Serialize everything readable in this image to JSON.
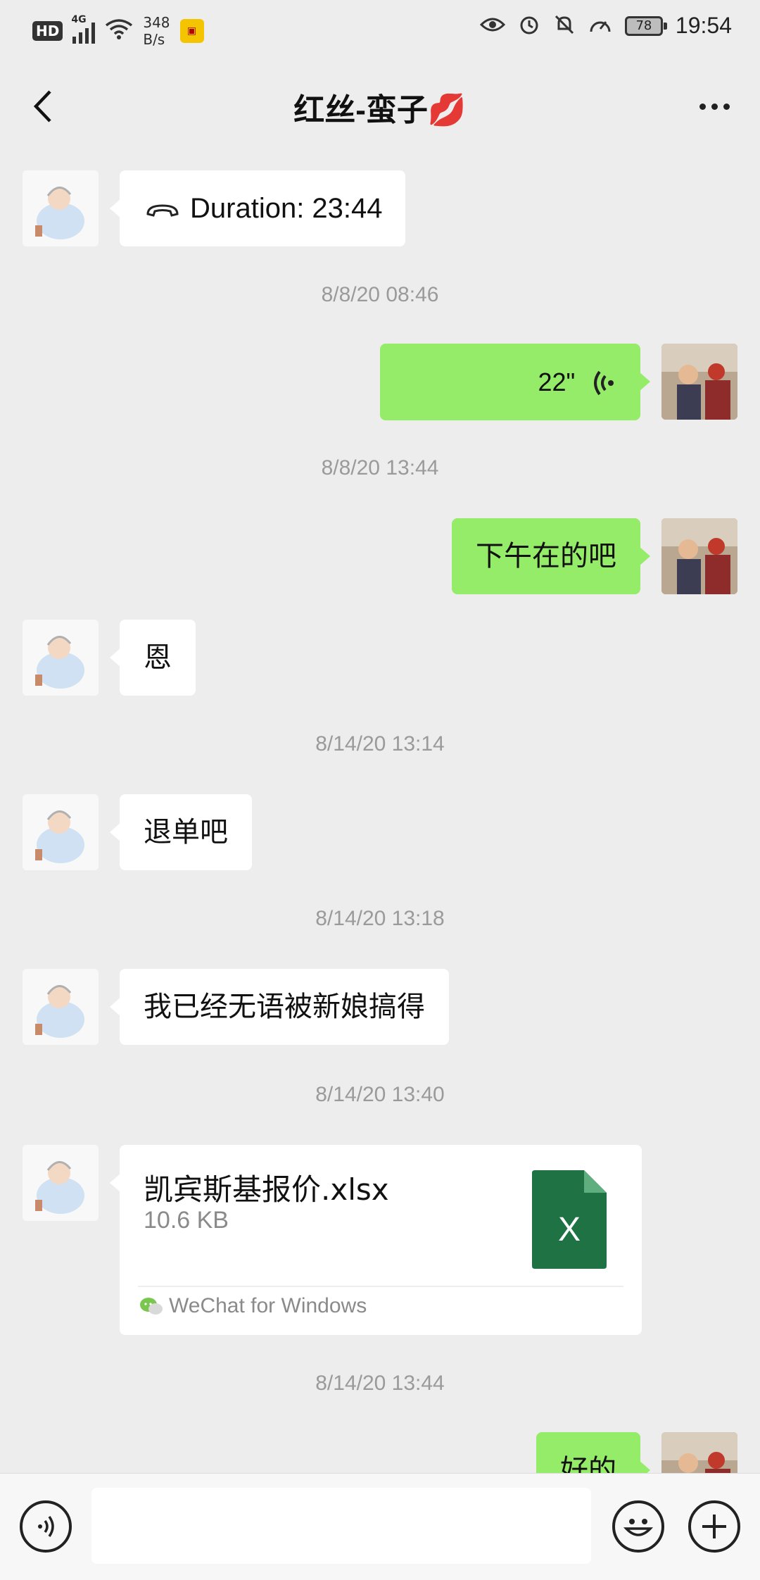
{
  "status_bar": {
    "network_badge": "HD",
    "network_type": "4G",
    "speed_value": "348",
    "speed_unit": "B/s",
    "battery": "78",
    "time": "19:54"
  },
  "header": {
    "title": "红丝-蛮子💋"
  },
  "messages": [
    {
      "side": "left",
      "type": "call",
      "text": "Duration: 23:44"
    },
    {
      "type": "timestamp",
      "text": "8/8/20 08:46"
    },
    {
      "side": "right",
      "type": "voice",
      "text": "22\""
    },
    {
      "type": "timestamp",
      "text": "8/8/20 13:44"
    },
    {
      "side": "right",
      "type": "text",
      "text": "下午在的吧"
    },
    {
      "side": "left",
      "type": "text",
      "text": "恩"
    },
    {
      "type": "timestamp",
      "text": "8/14/20 13:14"
    },
    {
      "side": "left",
      "type": "text",
      "text": "退单吧"
    },
    {
      "type": "timestamp",
      "text": "8/14/20 13:18"
    },
    {
      "side": "left",
      "type": "text",
      "text": "我已经无语被新娘搞得"
    },
    {
      "type": "timestamp",
      "text": "8/14/20 13:40"
    },
    {
      "side": "left",
      "type": "file",
      "file_name": "凯宾斯基报价.xlsx",
      "file_size": "10.6 KB",
      "source": "WeChat for Windows",
      "icon_letter": "X"
    },
    {
      "type": "timestamp",
      "text": "8/14/20 13:44"
    },
    {
      "side": "right",
      "type": "text",
      "text": "好的"
    }
  ],
  "input_bar": {
    "placeholder": ""
  },
  "colors": {
    "background": "#ededed",
    "sent_bubble": "#95ec69",
    "received_bubble": "#ffffff",
    "excel_green": "#1f7244",
    "timestamp_text": "#9a9a9a"
  },
  "icons": {
    "back": "chevron-left-icon",
    "more": "more-dots-icon",
    "call": "phone-hangup-icon",
    "voice": "voice-wave-icon",
    "file": "excel-file-icon",
    "source": "wechat-logo-icon",
    "voice_toggle": "voice-toggle-icon",
    "emoji": "emoji-icon",
    "plus": "plus-icon"
  }
}
